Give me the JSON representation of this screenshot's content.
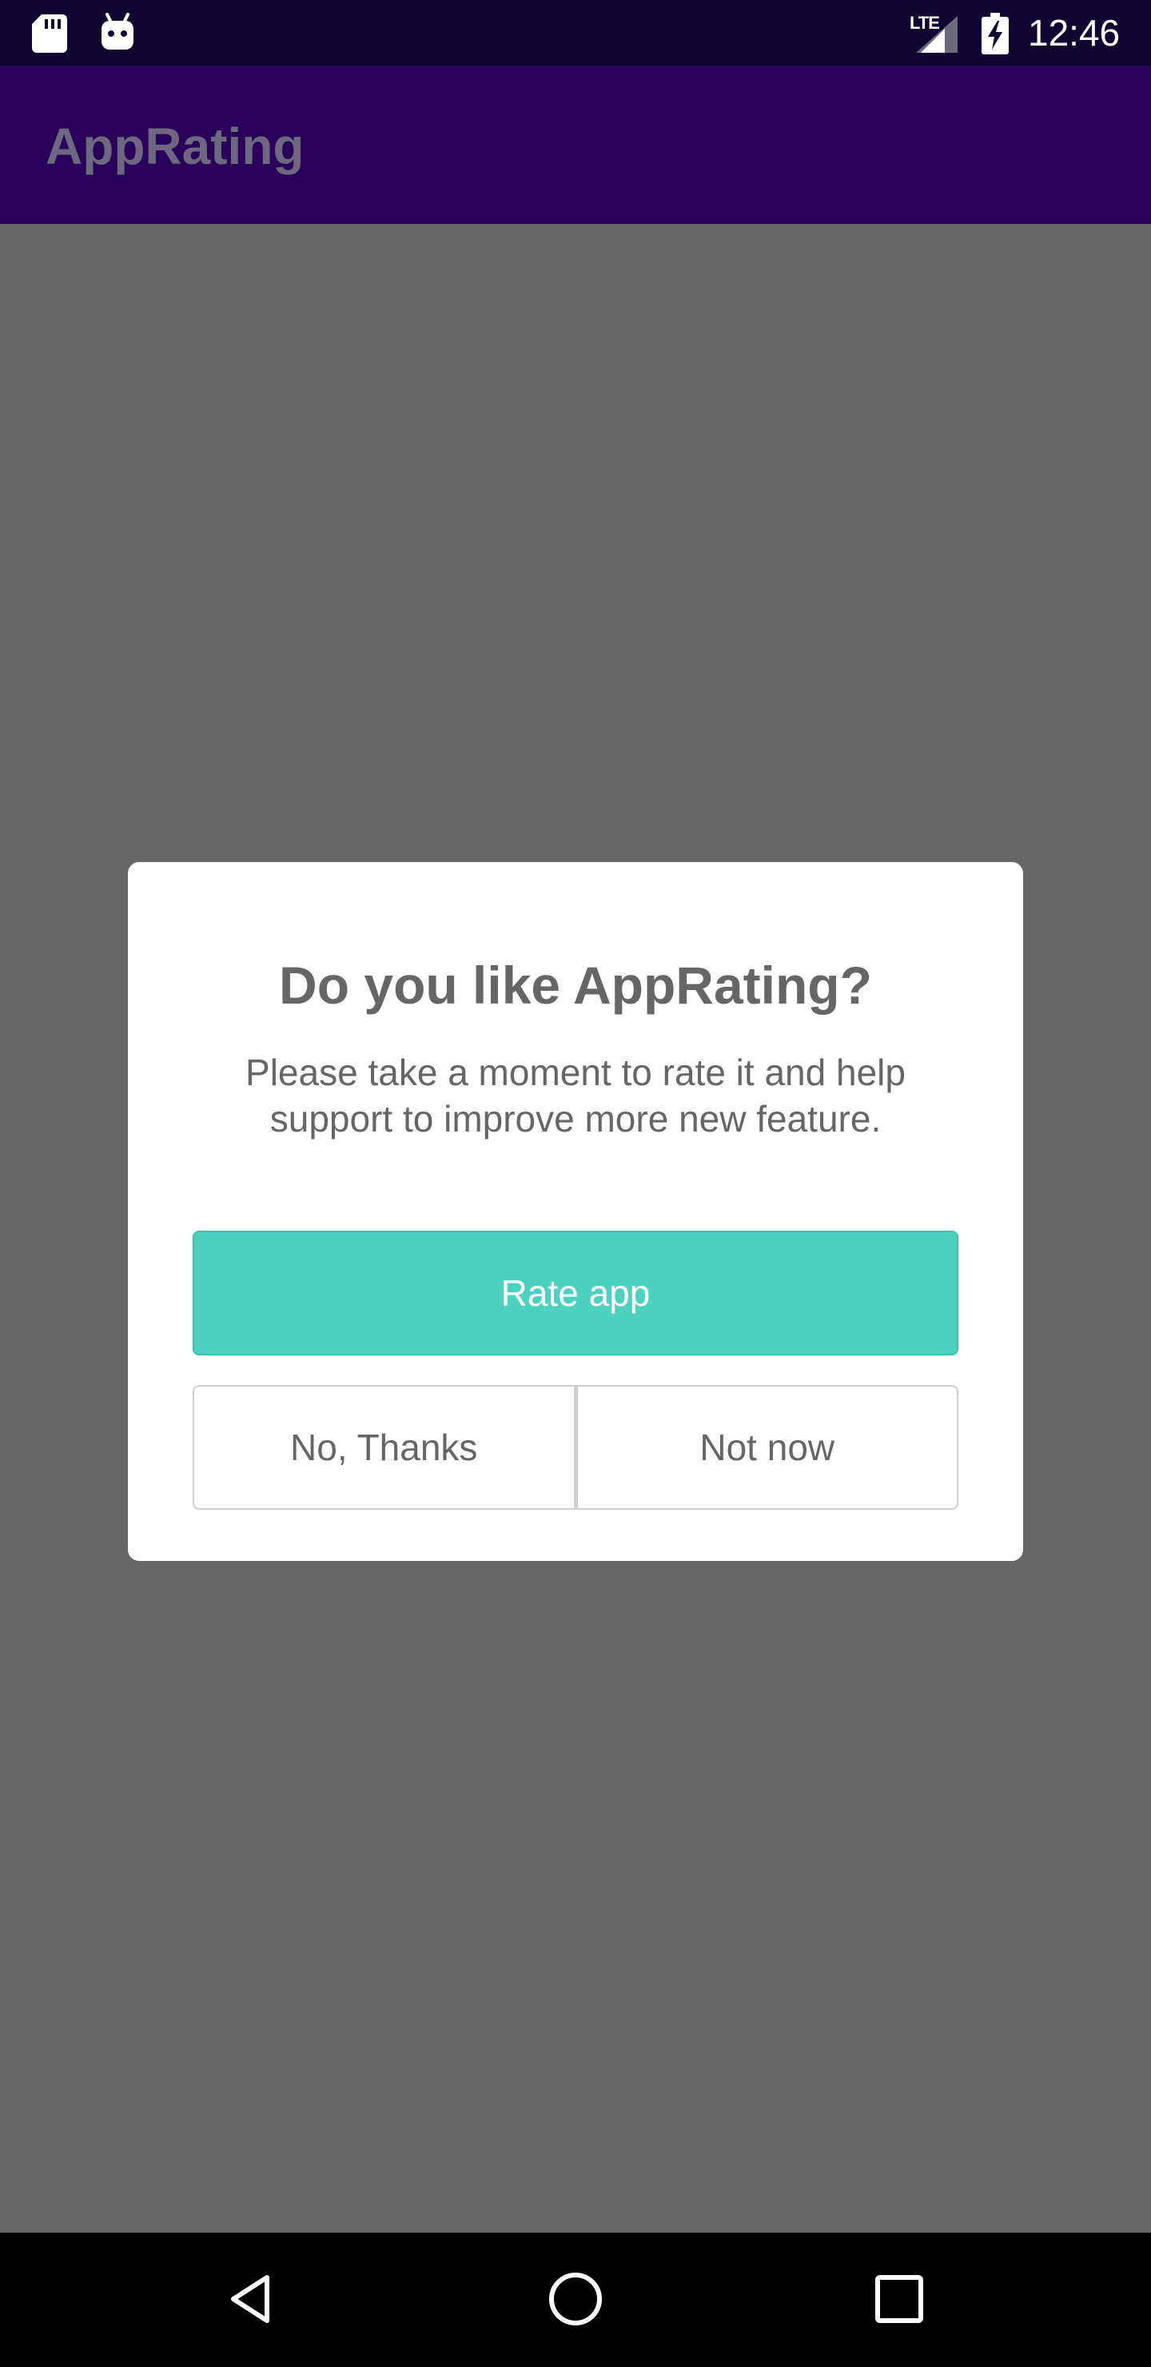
{
  "status_bar": {
    "network": "LTE",
    "time": "12:46",
    "icons": [
      "sd-card-icon",
      "android-icon",
      "signal-icon",
      "battery-charging-icon"
    ]
  },
  "app_bar": {
    "title": "AppRating"
  },
  "dialog": {
    "title": "Do you like AppRating?",
    "message": "Please take a moment to rate it and help support to improve more new feature.",
    "primary_button": "Rate app",
    "secondary_left": "No, Thanks",
    "secondary_right": "Not now"
  },
  "nav_bar": {
    "icons": [
      "back-icon",
      "home-icon",
      "recents-icon"
    ]
  },
  "colors": {
    "status_bar_bg": "#0f0530",
    "app_bar_bg": "#29015a",
    "scrim": "#666666",
    "accent": "#4dd2c1"
  }
}
